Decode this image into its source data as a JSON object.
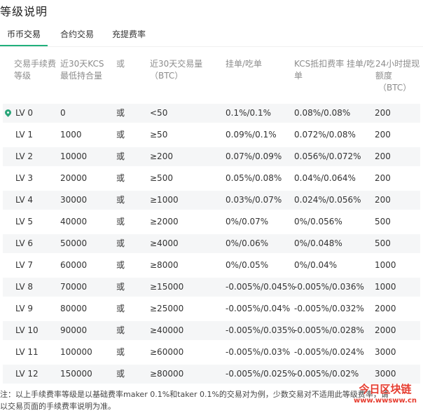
{
  "page": {
    "title": "等级说明"
  },
  "tabs": [
    {
      "label": "币币交易",
      "active": true
    },
    {
      "label": "合约交易",
      "active": false
    },
    {
      "label": "充提费率",
      "active": false
    }
  ],
  "accent_color": "#21b07c",
  "headers": {
    "level": "交易手续费等级",
    "kcs": "近30天KCS最低持合量",
    "or": "或",
    "volume_line1": "近30天交易量",
    "volume_line2": "（BTC）",
    "maker_taker": "挂单/吃单",
    "kcs_discount": "KCS抵扣费率 挂单/吃单",
    "withdraw_line1": "24小时提现额度",
    "withdraw_line2": "（BTC）"
  },
  "rows": [
    {
      "level": "LV 0",
      "kcs": "0",
      "or": "或",
      "volume": "<50",
      "fee": "0.1%/0.1%",
      "kcs_fee": "0.08%/0.08%",
      "withdraw": "200",
      "current": true
    },
    {
      "level": "LV 1",
      "kcs": "1000",
      "or": "或",
      "volume": "≥50",
      "fee": "0.09%/0.1%",
      "kcs_fee": "0.072%/0.08%",
      "withdraw": "200"
    },
    {
      "level": "LV 2",
      "kcs": "10000",
      "or": "或",
      "volume": "≥200",
      "fee": "0.07%/0.09%",
      "kcs_fee": "0.056%/0.072%",
      "withdraw": "200"
    },
    {
      "level": "LV 3",
      "kcs": "20000",
      "or": "或",
      "volume": "≥500",
      "fee": "0.05%/0.08%",
      "kcs_fee": "0.04%/0.064%",
      "withdraw": "200"
    },
    {
      "level": "LV 4",
      "kcs": "30000",
      "or": "或",
      "volume": "≥1000",
      "fee": "0.03%/0.07%",
      "kcs_fee": "0.024%/0.056%",
      "withdraw": "200"
    },
    {
      "level": "LV 5",
      "kcs": "40000",
      "or": "或",
      "volume": "≥2000",
      "fee": "0%/0.07%",
      "kcs_fee": "0%/0.056%",
      "withdraw": "500"
    },
    {
      "level": "LV 6",
      "kcs": "50000",
      "or": "或",
      "volume": "≥4000",
      "fee": "0%/0.06%",
      "kcs_fee": "0%/0.048%",
      "withdraw": "500"
    },
    {
      "level": "LV 7",
      "kcs": "60000",
      "or": "或",
      "volume": "≥8000",
      "fee": "0%/0.05%",
      "kcs_fee": "0%/0.04%",
      "withdraw": "1000"
    },
    {
      "level": "LV 8",
      "kcs": "70000",
      "or": "或",
      "volume": "≥15000",
      "fee": "-0.005%/0.045%",
      "kcs_fee": "-0.005%/0.036%",
      "withdraw": "1000"
    },
    {
      "level": "LV 9",
      "kcs": "80000",
      "or": "或",
      "volume": "≥25000",
      "fee": "-0.005%/0.04%",
      "kcs_fee": "-0.005%/0.032%",
      "withdraw": "2000"
    },
    {
      "level": "LV 10",
      "kcs": "90000",
      "or": "或",
      "volume": "≥40000",
      "fee": "-0.005%/0.035%",
      "kcs_fee": "-0.005%/0.028%",
      "withdraw": "2000"
    },
    {
      "level": "LV 11",
      "kcs": "100000",
      "or": "或",
      "volume": "≥60000",
      "fee": "-0.005%/0.03%",
      "kcs_fee": "-0.005%/0.024%",
      "withdraw": "3000"
    },
    {
      "level": "LV 12",
      "kcs": "150000",
      "or": "或",
      "volume": "≥80000",
      "fee": "-0.005%/0.025%",
      "kcs_fee": "-0.005%/0.02%",
      "withdraw": "3000"
    }
  ],
  "note": {
    "line1": "注：以上手续费率等级是以基础费率maker 0.1%和taker 0.1%的交易对为例，少数交易对不适用此等级费率，请",
    "line2": "以交易页面的手续费率说明为准。"
  },
  "watermark": {
    "top": "今日区块链",
    "bottom": "www.wwsww.cn"
  }
}
